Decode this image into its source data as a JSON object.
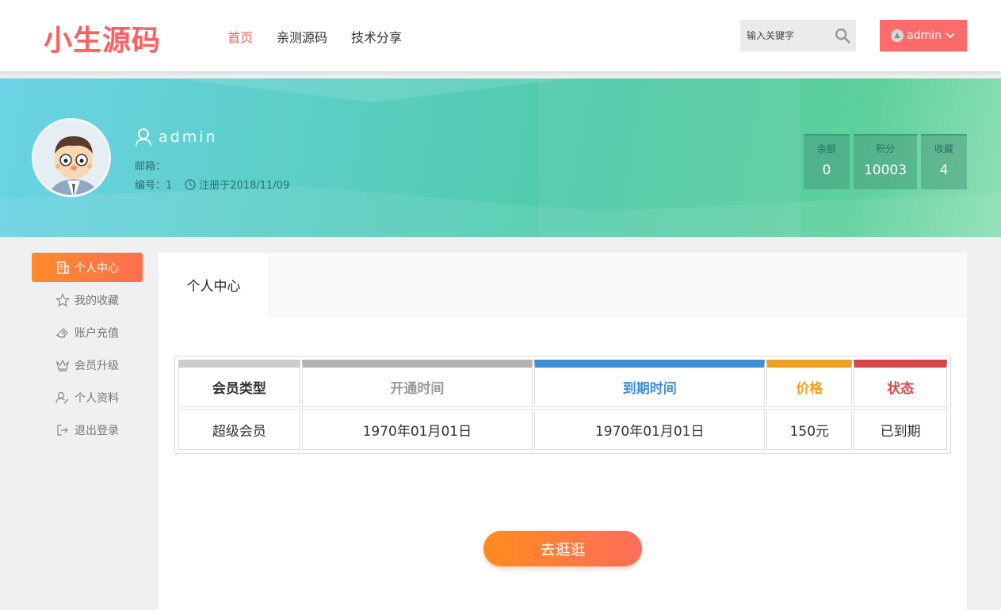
{
  "header": {
    "logo": "小生源码",
    "nav": [
      {
        "label": "首页",
        "active": true
      },
      {
        "label": "亲测源码",
        "active": false
      },
      {
        "label": "技术分享",
        "active": false
      }
    ],
    "search_placeholder": "输入关键字",
    "user_label": "admin"
  },
  "profile": {
    "username": "admin",
    "email_label": "邮箱：",
    "number_label": "编号：1",
    "registered": "注册于2018/11/09",
    "stats": [
      {
        "label": "余额",
        "value": "0"
      },
      {
        "label": "积分",
        "value": "10003"
      },
      {
        "label": "收藏",
        "value": "4"
      }
    ]
  },
  "sidebar": {
    "items": [
      {
        "label": "个人中心",
        "icon": "building-icon",
        "active": true
      },
      {
        "label": "我的收藏",
        "icon": "star-icon",
        "active": false
      },
      {
        "label": "账户充值",
        "icon": "wallet-icon",
        "active": false
      },
      {
        "label": "会员升级",
        "icon": "crown-icon",
        "active": false
      },
      {
        "label": "个人资料",
        "icon": "user-edit-icon",
        "active": false
      },
      {
        "label": "退出登录",
        "icon": "logout-icon",
        "active": false
      }
    ]
  },
  "main": {
    "tab_label": "个人中心",
    "table": {
      "headers": [
        {
          "label": "会员类型",
          "color": "#333333",
          "bar": "#cccccc"
        },
        {
          "label": "开通时间",
          "color": "#999999",
          "bar": "#b3b3b3"
        },
        {
          "label": "到期时间",
          "color": "#3d8fd6",
          "bar": "#3d8fd6"
        },
        {
          "label": "价格",
          "color": "#f0a020",
          "bar": "#f0a020"
        },
        {
          "label": "状态",
          "color": "#d94848",
          "bar": "#d94848"
        }
      ],
      "rows": [
        [
          "超级会员",
          "1970年01月01日",
          "1970年01月01日",
          "150元",
          "已到期"
        ]
      ]
    },
    "button_label": "去逛逛"
  }
}
